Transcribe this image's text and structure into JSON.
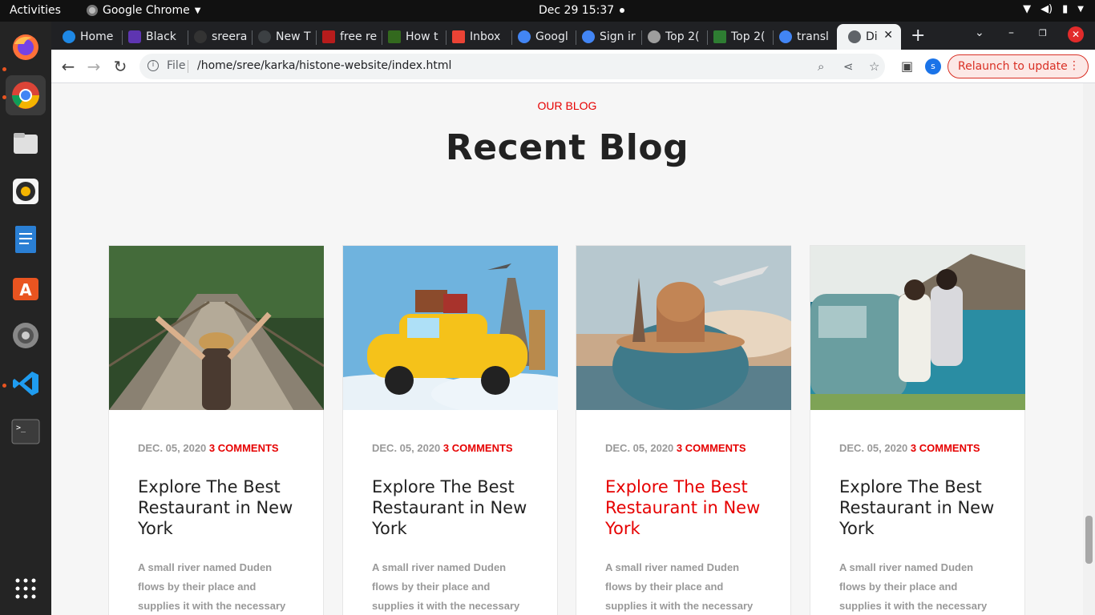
{
  "topbar": {
    "activities": "Activities",
    "app_name": "Google Chrome",
    "clock": "Dec 29  15:37"
  },
  "browser": {
    "tabs": [
      {
        "label": "Home",
        "icon_color": "#1e88e5"
      },
      {
        "label": "Black",
        "icon_color": "#5e35b1"
      },
      {
        "label": "sreera",
        "icon_color": "#333333"
      },
      {
        "label": "New T",
        "icon_color": "#3c4043"
      },
      {
        "label": "free re",
        "icon_color": "#b71c1c"
      },
      {
        "label": "How t",
        "icon_color": "#33691e"
      },
      {
        "label": "Inbox",
        "icon_color": "#ea4335"
      },
      {
        "label": "Googl",
        "icon_color": "#4285f4"
      },
      {
        "label": "Sign ir",
        "icon_color": "#4285f4"
      },
      {
        "label": "Top 2(",
        "icon_color": "#9e9e9e"
      },
      {
        "label": "Top 2(",
        "icon_color": "#2e7d32"
      },
      {
        "label": "transl",
        "icon_color": "#4285f4"
      },
      {
        "label": "Di",
        "icon_color": "#5f6368"
      }
    ],
    "omnibox": {
      "scheme_label": "File",
      "url": "/home/sree/karka/histone-website/index.html"
    },
    "profile_initial": "s",
    "relaunch_label": "Relaunch to update"
  },
  "page": {
    "kicker": "OUR BLOG",
    "heading": "Recent Blog",
    "accent_color": "#e60000",
    "cards": [
      {
        "date": "DEC. 05, 2020",
        "comments": "3 COMMENTS",
        "title": "Explore The Best Restaurant in New York",
        "excerpt": "A small river named Duden flows by their place and supplies it with the necessary",
        "image": "woman-on-rope-bridge"
      },
      {
        "date": "DEC. 05, 2020",
        "comments": "3 COMMENTS",
        "title": "Explore The Best Restaurant in New York",
        "excerpt": "A small river named Duden flows by their place and supplies it with the necessary",
        "image": "yellow-car-with-luggage"
      },
      {
        "date": "DEC. 05, 2020",
        "comments": "3 COMMENTS",
        "title": "Explore The Best Restaurant in New York",
        "excerpt": "A small river named Duden flows by their place and supplies it with the necessary",
        "image": "globe-with-landmarks"
      },
      {
        "date": "DEC. 05, 2020",
        "comments": "3 COMMENTS",
        "title": "Explore The Best Restaurant in New York",
        "excerpt": "A small river named Duden flows by their place and supplies it with the necessary",
        "image": "couple-by-car-at-sea"
      }
    ]
  }
}
